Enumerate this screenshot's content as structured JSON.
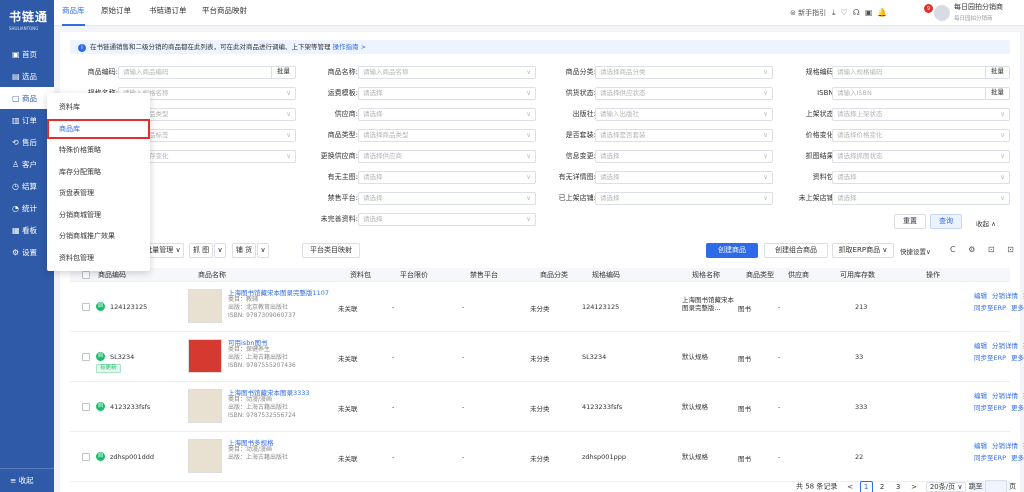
{
  "app": {
    "logo": "书链通",
    "logo_sub": "SHULIANTONG"
  },
  "sidebar": {
    "items": [
      {
        "icon": "▣",
        "label": "首页"
      },
      {
        "icon": "▤",
        "label": "选品"
      },
      {
        "icon": "▢",
        "label": "商品"
      },
      {
        "icon": "▥",
        "label": "订单"
      },
      {
        "icon": "⟲",
        "label": "售后"
      },
      {
        "icon": "♙",
        "label": "客户"
      },
      {
        "icon": "◷",
        "label": "结算"
      },
      {
        "icon": "◔",
        "label": "统计"
      },
      {
        "icon": "▦",
        "label": "看板"
      },
      {
        "icon": "⚙",
        "label": "设置"
      }
    ],
    "footer": "≡ 收起"
  },
  "topbar": {
    "tabs": [
      "商品库",
      "原始订单",
      "书链通订单",
      "平台商品映射"
    ],
    "guide": "⊜ 新手指引",
    "user_name": "每日园拍分销商",
    "user_sub": "每日园拍分销商",
    "badge": "9"
  },
  "notice": {
    "text": "在书链通销售和二级分销的商品都在此列表，可在此对商品进行调编、上下架等管理",
    "link": "操作指南 >"
  },
  "filters": {
    "r1": [
      {
        "label": "商品编码:",
        "ph": "请输入商品编码",
        "batch": "批量"
      },
      {
        "label": "商品名称:",
        "ph": "请输入商品名称"
      },
      {
        "label": "商品分类:",
        "ph": "请选择商品分类"
      },
      {
        "label": "规格编码:",
        "ph": "请输入规格编码",
        "batch": "批量"
      }
    ],
    "r2": [
      {
        "label": "规格名称:",
        "ph": "请输入规格名称"
      },
      {
        "label": "运费模板:",
        "ph": "请选择"
      },
      {
        "label": "供货状态:",
        "ph": "请选择供应状态"
      },
      {
        "label": "ISBN:",
        "ph": "请输入ISBN",
        "batch": "批量"
      }
    ],
    "r3": [
      {
        "label": "商品类型:",
        "ph": "请选择商品类型"
      },
      {
        "label": "供应商:",
        "ph": "请选择"
      },
      {
        "label": "出版社:",
        "ph": "请输入出版社"
      },
      {
        "label": "上架状态:",
        "ph": "请选择上架状态"
      }
    ],
    "r4": [
      {
        "label": "商品标签:",
        "ph": "请选择商品标签"
      },
      {
        "label": "商品类型:",
        "ph": "请选择商品类型"
      },
      {
        "label": "是否套装:",
        "ph": "请选择是否套装"
      },
      {
        "label": "价格变化:",
        "ph": "请选择价格变化"
      }
    ],
    "r5": [
      {
        "label": "库存变化:",
        "ph": "请选择库存变化"
      },
      {
        "label": "更换供应商:",
        "ph": "请选择供应商"
      },
      {
        "label": "信息变更:",
        "ph": "请选择"
      },
      {
        "label": "抓图结果:",
        "ph": "请选择抓图状态"
      }
    ],
    "r6": [
      {
        "label": "有无主图:",
        "ph": "请选择"
      },
      {
        "label": "有无详情图:",
        "ph": "请选择"
      },
      {
        "label": "资料包:",
        "ph": "请选择"
      }
    ],
    "r7": [
      {
        "label": "禁售平台:",
        "ph": "请选择"
      },
      {
        "label": "已上架店铺:",
        "ph": "请选择"
      },
      {
        "label": "未上架店铺:",
        "ph": "请选择"
      }
    ],
    "r8": [
      {
        "label": "未完善资料:",
        "ph": "请选择"
      }
    ],
    "reset": "重置",
    "query": "查询",
    "collapse": "收起 ∧"
  },
  "toolbar": {
    "left": [
      "批量管理 ∨",
      "抓 图",
      "∨",
      "铺 货",
      "∨",
      "平台类目映射"
    ],
    "create": "创建商品",
    "create_combo": "创建组合商品",
    "grab_erp": "抓取ERP商品 ∨",
    "quick": "快捷设置∨",
    "icons": "C ⚙ ⊡ ⊡"
  },
  "table": {
    "headers": [
      "商品编码",
      "商品名称",
      "资料包",
      "平台限价",
      "禁售平台",
      "商品分类",
      "规格编码",
      "规格名称",
      "商品类型",
      "供应商",
      "可用库存数",
      "操作"
    ],
    "rows": [
      {
        "code": "124123125",
        "name": "上海图书馆藏宋本图录完整版1107",
        "m1": "类目：教辅",
        "m2": "出版：北京教育出版社",
        "m3": "ISBN: 9787309060737",
        "pkg": "未关联",
        "price": "-",
        "ban": "-",
        "cat": "未分类",
        "spec": "124123125",
        "spec_name": "上海图书馆藏宋本图录完整版...",
        "type": "图书",
        "sup": "-",
        "stock": "213",
        "tag": ""
      },
      {
        "code": "SL3234",
        "name": "可用isbn图书",
        "m1": "类目：保健养生",
        "m2": "出版：上海古籍出版社",
        "m3": "ISBN: 9787555207436",
        "pkg": "未关联",
        "price": "-",
        "ban": "-",
        "cat": "未分类",
        "spec": "SL3234",
        "spec_name": "默认规格",
        "type": "图书",
        "sup": "-",
        "stock": "33",
        "tag": "有更新"
      },
      {
        "code": "4123233fsfs",
        "name": "上海图书馆藏宋本图录3333",
        "m1": "类目：动漫/漫画",
        "m2": "出版：上海古籍出版社",
        "m3": "ISBN: 9787532556724",
        "pkg": "未关联",
        "price": "-",
        "ban": "-",
        "cat": "未分类",
        "spec": "4123233fsfs",
        "spec_name": "默认规格",
        "type": "图书",
        "sup": "-",
        "stock": "333",
        "tag": ""
      },
      {
        "code": "zdhsp001ddd",
        "name": "上海图书多规格",
        "m1": "类目：动漫/漫画",
        "m2": "出版：上海古籍出版社",
        "m3": "",
        "pkg": "未关联",
        "price": "-",
        "ban": "-",
        "cat": "未分类",
        "spec": "zdhsp001ppp",
        "spec_name": "默认规格",
        "type": "图书",
        "sup": "-",
        "stock": "22",
        "tag": ""
      }
    ],
    "ops": [
      "编辑",
      "分销详情",
      "操作日志",
      "同步至ERP",
      "更多 ∨"
    ]
  },
  "dropdown": [
    "资料库",
    "商品库",
    "特殊价格策略",
    "库存分配策略",
    "货盘表管理",
    "分销商城管理",
    "分销商城推广效果",
    "资料包管理"
  ],
  "pager": {
    "total": "共 58 条记录",
    "prev": "<",
    "pages": [
      "1",
      "2",
      "3"
    ],
    "next": ">",
    "size": "20条/页 ∨",
    "goto": "跳至",
    "page": "页"
  }
}
